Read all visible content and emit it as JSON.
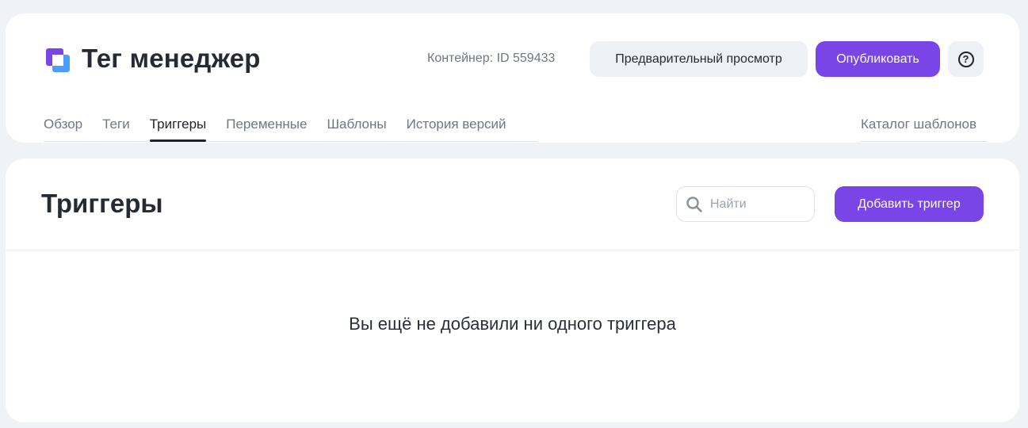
{
  "header": {
    "brand_title": "Тег менеджер",
    "container_id": "Контейнер: ID 559433",
    "preview_label": "Предварительный просмотр",
    "publish_label": "Опубликовать",
    "help_label": "?"
  },
  "tabs": [
    {
      "label": "Обзор",
      "active": false
    },
    {
      "label": "Теги",
      "active": false
    },
    {
      "label": "Триггеры",
      "active": true
    },
    {
      "label": "Переменные",
      "active": false
    },
    {
      "label": "Шаблоны",
      "active": false
    },
    {
      "label": "История версий",
      "active": false
    }
  ],
  "catalog_label": "Каталог шаблонов",
  "main": {
    "title": "Триггеры",
    "search_placeholder": "Найти",
    "search_value": "",
    "add_label": "Добавить триггер",
    "empty_message": "Вы ещё не добавили ни одного триггера"
  },
  "icons": {
    "logo": "tag-manager-logo-icon",
    "help": "help-circle-icon",
    "search": "search-icon"
  },
  "colors": {
    "accent": "#7a45e6",
    "logo_purple": "#7a45e6",
    "logo_blue": "#4d9cff",
    "background": "#eff2f6"
  }
}
